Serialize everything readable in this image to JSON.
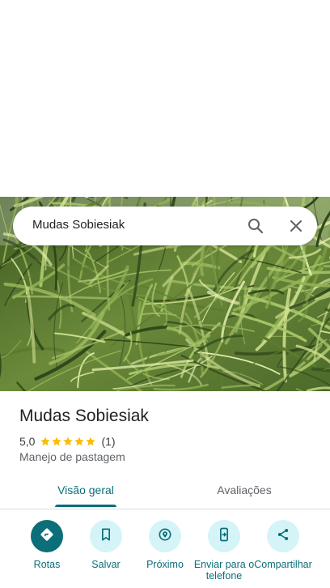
{
  "search": {
    "query": "Mudas Sobiesiak"
  },
  "place": {
    "name": "Mudas Sobiesiak",
    "rating": "5,0",
    "stars": 5,
    "review_count": "(1)",
    "category": "Manejo de pastagem"
  },
  "tabs": [
    {
      "label": "Visão geral",
      "selected": true
    },
    {
      "label": "Avaliações",
      "selected": false
    }
  ],
  "actions": [
    {
      "label": "Rotas",
      "icon": "directions-icon"
    },
    {
      "label": "Salvar",
      "icon": "bookmark-icon"
    },
    {
      "label": "Próximo",
      "icon": "nearby-icon"
    },
    {
      "label": "Enviar para o telefone",
      "icon": "send-to-phone-icon"
    },
    {
      "label": "Compartilhar",
      "icon": "share-icon"
    }
  ],
  "colors": {
    "accent": "#0b6e78",
    "action_bg": "#d4f4f8",
    "star": "#fbbc04"
  }
}
